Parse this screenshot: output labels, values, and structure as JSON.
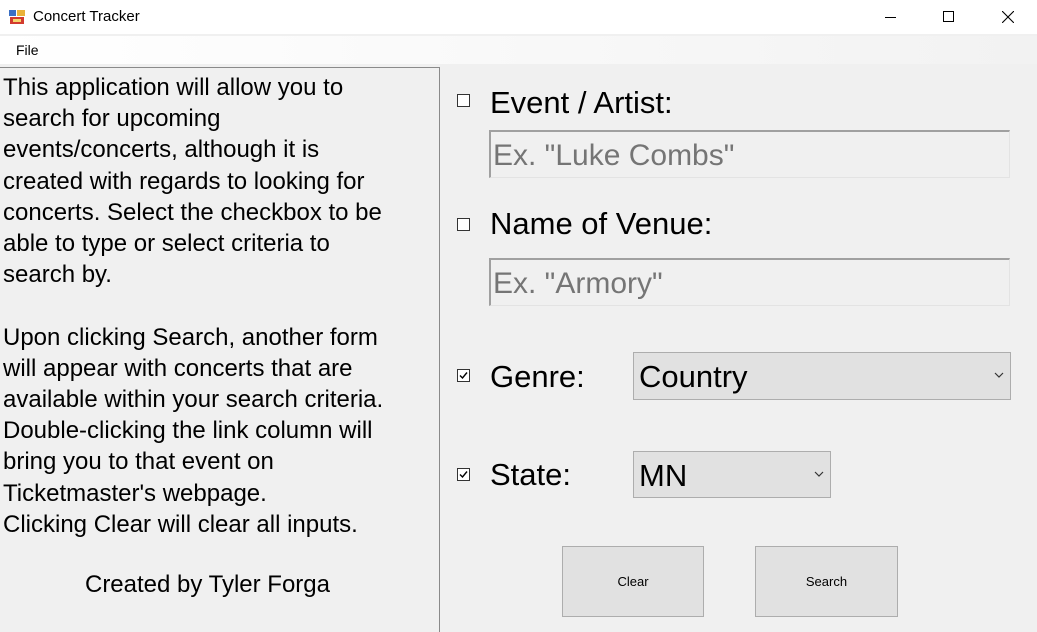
{
  "window": {
    "title": "Concert Tracker",
    "icons": {
      "app": "app-icon",
      "minimize": "minimize-icon",
      "maximize": "maximize-icon",
      "close": "close-icon"
    }
  },
  "menu": {
    "file": "File"
  },
  "info": {
    "description": "This application will allow you to\nsearch for upcoming\nevents/concerts, although it is\ncreated with regards to looking for\nconcerts. Select the checkbox to be\nable to type or select criteria to\nsearch by.\n\nUpon clicking Search, another form\nwill appear with concerts that are\navailable within your search criteria.\nDouble-clicking the link column will\nbring you to that event on\nTicketmaster's webpage.\nClicking Clear will clear all inputs.",
    "credit": "Created by Tyler Forga"
  },
  "form": {
    "event": {
      "label": "Event / Artist:",
      "checked": false,
      "placeholder": "Ex. \"Luke Combs\""
    },
    "venue": {
      "label": "Name of Venue:",
      "checked": false,
      "placeholder": "Ex. \"Armory\""
    },
    "genre": {
      "label": "Genre:",
      "checked": true,
      "selected": "Country"
    },
    "state": {
      "label": "State:",
      "checked": true,
      "selected": "MN"
    }
  },
  "buttons": {
    "clear": "Clear",
    "search": "Search"
  },
  "colors": {
    "window_bg": "#f0f0f0",
    "titlebar_bg": "#ffffff",
    "control_bg": "#e1e1e1",
    "control_border": "#adadad"
  }
}
